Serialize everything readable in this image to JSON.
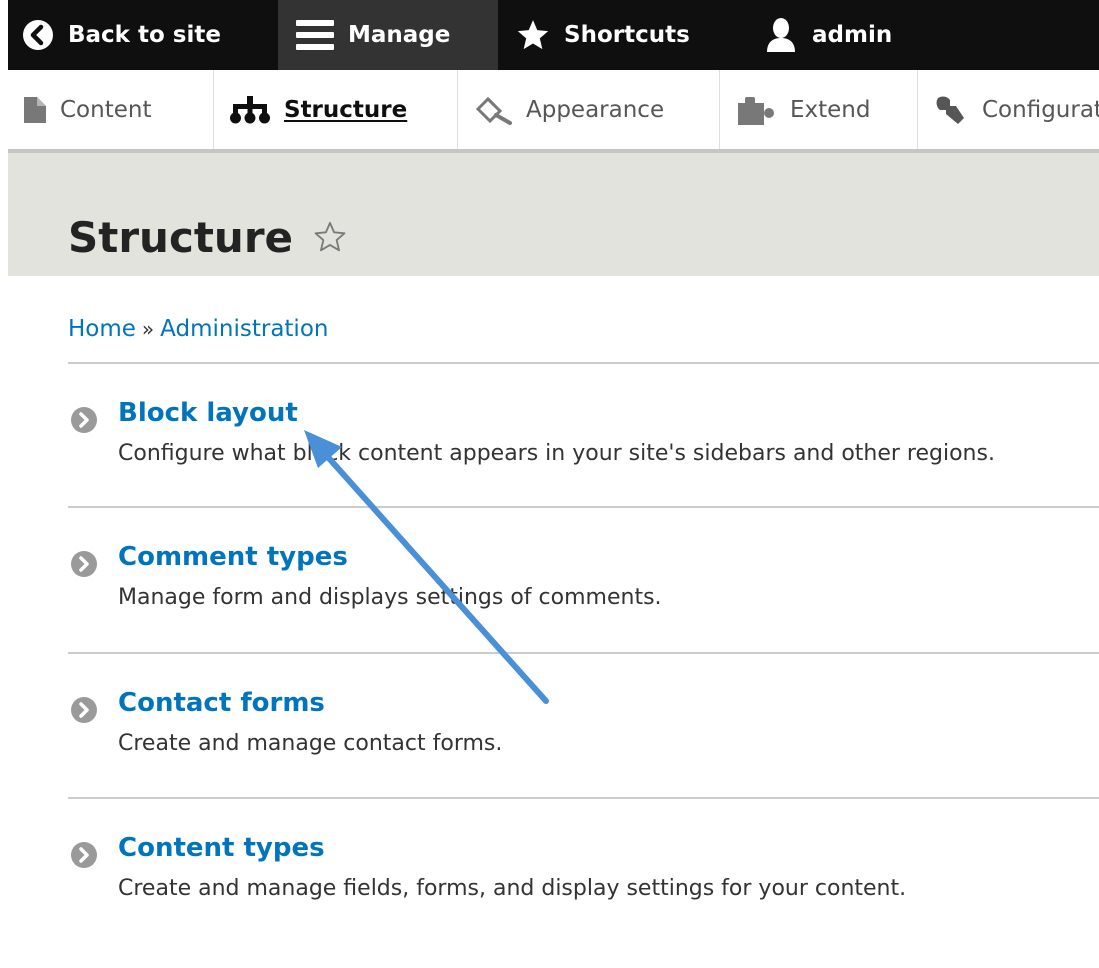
{
  "toolbar": {
    "back_to_site": "Back to site",
    "manage": "Manage",
    "shortcuts": "Shortcuts",
    "user": "admin"
  },
  "tray": {
    "items": [
      {
        "label": "Content",
        "icon": "file-icon"
      },
      {
        "label": "Structure",
        "icon": "hierarchy-icon",
        "active": true
      },
      {
        "label": "Appearance",
        "icon": "paintbrush-icon"
      },
      {
        "label": "Extend",
        "icon": "puzzle-icon"
      },
      {
        "label": "Configuration",
        "icon": "wrench-icon"
      }
    ]
  },
  "page": {
    "title": "Structure"
  },
  "breadcrumb": {
    "items": [
      "Home",
      "Administration"
    ],
    "separator": "»"
  },
  "admin_list": [
    {
      "title": "Block layout",
      "description": "Configure what block content appears in your site's sidebars and other regions."
    },
    {
      "title": "Comment types",
      "description": "Manage form and displays settings of comments."
    },
    {
      "title": "Contact forms",
      "description": "Create and manage contact forms."
    },
    {
      "title": "Content types",
      "description": "Create and manage fields, forms, and display settings for your content."
    }
  ],
  "colors": {
    "toolbar_bg": "#0f0f0f",
    "link": "#0074bd",
    "header_bg": "#e3e3de",
    "annotation_arrow": "#4a90d9"
  }
}
